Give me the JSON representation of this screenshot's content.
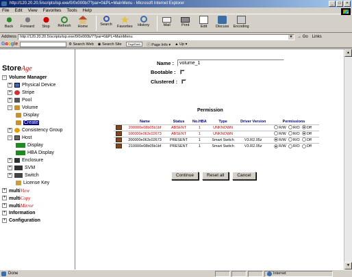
{
  "window": {
    "title": "http://120.20.20.5/scripts/isp.exe/0/0x000b/7?par=0&PL=MainMenu - Microsoft Internet Explorer"
  },
  "menu": [
    "File",
    "Edit",
    "View",
    "Favorites",
    "Tools",
    "Help"
  ],
  "toolbar": {
    "back": "Back",
    "forward": "Forward",
    "stop": "Stop",
    "refresh": "Refresh",
    "home": "Home",
    "search": "Search",
    "favorites": "Favorites",
    "history": "History",
    "mail": "Mail",
    "print": "Print",
    "edit": "Edit",
    "discuss": "Discuss",
    "encoding": "Encoding"
  },
  "address": {
    "label": "Address",
    "value": "http://120.20.20.5/scripts/isp.exe/0/0x000b/7?par=0&PL=MainMenu",
    "go": "Go",
    "links": "Links"
  },
  "google": {
    "logo": [
      "G",
      "o",
      "o",
      "g",
      "l",
      "e"
    ],
    "search_web": "Search Web",
    "search_site": "Search Site",
    "pagerank": "PageRank",
    "page_info": "Page Info",
    "up": "Up"
  },
  "sidebar": {
    "logo_store": "Store",
    "logo_age": "Age",
    "volume_manager": "Volume Manager",
    "physical_device": "Physical Device",
    "stripe": "Stripe",
    "pool": "Pool",
    "volume": "Volume",
    "display": "Display",
    "create": "Create",
    "consistency_group": "Consistency Group",
    "host": "Host",
    "host_display": "Display",
    "hba_display": "HBA Display",
    "enclosure": "Enclosure",
    "svm": "SVM",
    "switch": "Switch",
    "license_key": "License Key",
    "multi_view": {
      "a": "multi",
      "b": "View"
    },
    "multi_copy": {
      "a": "multi",
      "b": "Copy"
    },
    "multi_mirror": {
      "a": "multi",
      "b": "Mirror"
    },
    "information": "Information",
    "configuration": "Configuration"
  },
  "form": {
    "name_label": "Name :",
    "name_value": "volume_1",
    "bootable_label": "Bootable :",
    "clustered_label": "Clustered :"
  },
  "permission": {
    "title": "Permission",
    "headers": [
      "Name",
      "Status",
      "No.HBA",
      "Type",
      "Driver Version",
      "Permissions"
    ],
    "options": [
      "R/W",
      "R/O",
      "Off"
    ],
    "rows": [
      {
        "name": "200000e08b05b1bf",
        "status": "ABSENT",
        "hba": "1",
        "type": "UNKNOWN",
        "driver": "",
        "selected": 2,
        "absent": true
      },
      {
        "name": "100000e063c02673",
        "status": "ABSENT",
        "hba": "1",
        "type": "UNKNOWN",
        "driver": "",
        "selected": 2,
        "absent": true
      },
      {
        "name": "200000e063c02673",
        "status": "PRESENT",
        "hba": "1",
        "type": "Smart Switch",
        "driver": "V3.R2.05z",
        "selected": 0,
        "absent": false
      },
      {
        "name": "210000e08b05b1bf",
        "status": "PRESENT",
        "hba": "1",
        "type": "Smart Switch",
        "driver": "V3.R2.05z",
        "selected": 0,
        "absent": false
      }
    ]
  },
  "buttons": {
    "continue": "Continue",
    "reset": "Reset all",
    "cancel": "Cancel"
  },
  "status": {
    "text": "Done",
    "zone": "Internet"
  }
}
